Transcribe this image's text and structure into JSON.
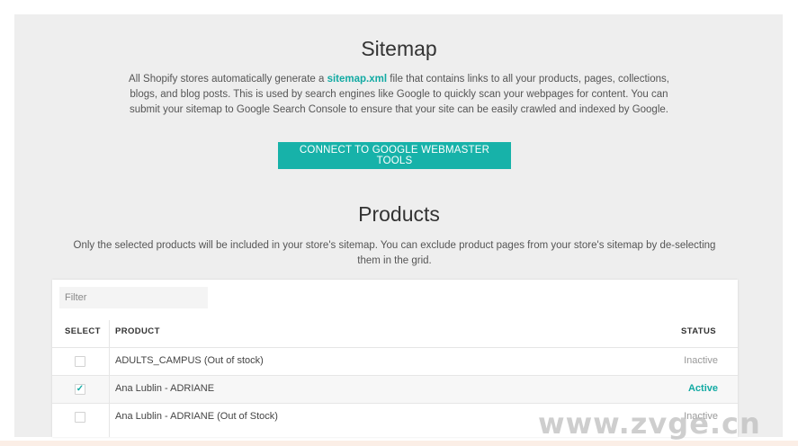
{
  "sitemap": {
    "title": "Sitemap",
    "desc_before": "All Shopify stores automatically generate a ",
    "desc_link": "sitemap.xml",
    "desc_line1_after": " file that contains links to all your products, pages, collections,",
    "desc_line2": "blogs, and blog posts. This is used by search engines like Google to quickly scan your webpages for content. You can",
    "desc_line3": "submit your sitemap to Google Search Console to ensure that your site can be easily crawled and indexed by Google.",
    "connect_button": "CONNECT TO GOOGLE WEBMASTER TOOLS"
  },
  "products": {
    "title": "Products",
    "desc_line1": "Only the selected products will be included in your store's sitemap. You can exclude product pages from your store's sitemap by de-selecting",
    "desc_line2": "them in the grid.",
    "filter_placeholder": "Filter",
    "headers": {
      "select": "SELECT",
      "product": "PRODUCT",
      "status": "STATUS"
    },
    "rows": [
      {
        "name": "ADULTS_CAMPUS (Out of stock)",
        "status": "Inactive",
        "selected": false
      },
      {
        "name": "Ana Lublin - ADRIANE",
        "status": "Active",
        "selected": true
      },
      {
        "name": "Ana Lublin - ADRIANE (Out of Stock)",
        "status": "Inactive",
        "selected": false
      }
    ]
  },
  "watermark": "www.zvge.cn",
  "colors": {
    "accent": "#17b2a9",
    "panel": "#eeeeee",
    "active_status": "#12aaa3"
  }
}
